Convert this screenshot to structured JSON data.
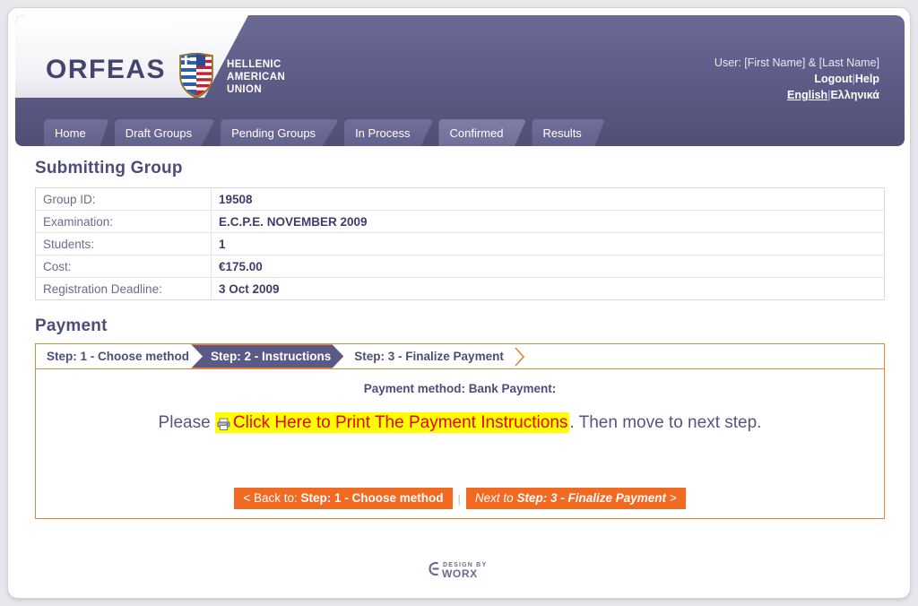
{
  "header": {
    "brand": "ORFEAS",
    "org_name_lines": [
      "HELLENIC",
      "AMERICAN",
      "UNION"
    ],
    "shield_icon": "hellenic-american-union-shield",
    "user_label": "User: [First Name] & [Last Name]",
    "logout_label": "Logout",
    "help_label": "Help",
    "lang_en": "English",
    "lang_el": "Ελληνικά",
    "separator": "|"
  },
  "nav": {
    "tabs": [
      {
        "label": "Home",
        "active": false
      },
      {
        "label": "Draft Groups",
        "active": false
      },
      {
        "label": "Pending Groups",
        "active": false
      },
      {
        "label": "In Process",
        "active": false
      },
      {
        "label": "Confirmed",
        "active": true
      },
      {
        "label": "Results",
        "active": false
      }
    ]
  },
  "page": {
    "title": "Submitting Group",
    "payment_title": "Payment"
  },
  "group_info": {
    "rows": [
      {
        "label": "Group ID:",
        "value": "19508"
      },
      {
        "label": "Examination:",
        "value": "E.C.P.E. NOVEMBER 2009"
      },
      {
        "label": "Students:",
        "value": "1"
      },
      {
        "label": "Cost:",
        "value": "€175.00"
      },
      {
        "label": "Registration Deadline:",
        "value": "3 Oct 2009"
      }
    ]
  },
  "payment": {
    "steps": [
      {
        "label": "Step: 1 - Choose method",
        "active": false
      },
      {
        "label": "Step: 2 - Instructions",
        "active": true
      },
      {
        "label": "Step: 3 - Finalize Payment",
        "active": false
      }
    ],
    "method_line": "Payment method: Bank Payment:",
    "instruction_prefix": "Please ",
    "print_link_label": "Click Here to Print The Payment Instructions",
    "print_icon": "printer-icon",
    "instruction_suffix": ". Then move to next step.",
    "back_button": {
      "prefix": "< Back to: ",
      "bold": "Step: 1 - Choose method"
    },
    "next_button": {
      "prefix": "Next to ",
      "bold": "Step: 3 - Finalize Payment",
      "suffix": " >"
    },
    "button_separator": "|"
  },
  "footer": {
    "design_by": "DESIGN BY",
    "company": "WORX",
    "logo_icon": "eworx-logo"
  },
  "colors": {
    "header_purple": "#5d5d88",
    "accent_orange": "#f26a21",
    "step_active": "#5a5a87",
    "link_red": "#ee0000",
    "highlight_yellow": "#ffff00",
    "heading_blue": "#4d4d7a"
  }
}
